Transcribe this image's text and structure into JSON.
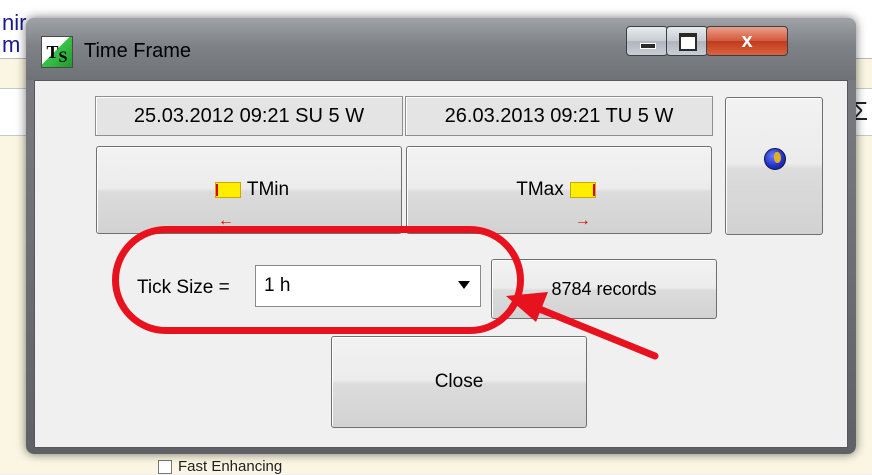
{
  "background": {
    "left_text": "nir\nm",
    "sigma": "Σ",
    "bottom_label": "Fast Enhancing"
  },
  "dialog": {
    "icon_text": "T",
    "icon_sub": "S",
    "title": "Time Frame",
    "close_glyph": "x",
    "date_min": "25.03.2012  09:21 SU  5 W",
    "date_max": "26.03.2013  09:21 TU  5 W",
    "tmin_label": "TMin",
    "tmax_label": "TMax",
    "tick_size_label": "Tick Size =",
    "tick_size_value": "1 h",
    "records_label": "8784 records",
    "close_label": "Close"
  },
  "colors": {
    "annotation_red": "#e8121f",
    "accent_yellow": "#ffee00"
  },
  "icons": [
    "app-ts-icon",
    "minimize-icon",
    "maximize-icon",
    "close-icon",
    "arrow-left-icon",
    "arrow-right-icon",
    "globe-icon",
    "chevron-down-icon"
  ]
}
